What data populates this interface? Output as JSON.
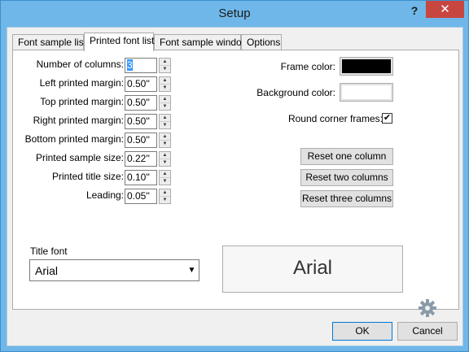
{
  "window": {
    "title": "Setup",
    "help_label": "?",
    "close_label": "✕"
  },
  "tabs": [
    {
      "label": "Font sample list",
      "active": false
    },
    {
      "label": "Printed font list",
      "active": true
    },
    {
      "label": "Font sample window",
      "active": false
    },
    {
      "label": "Options",
      "active": false
    }
  ],
  "fields": {
    "columns": {
      "label": "Number of columns:",
      "value": "3"
    },
    "left_margin": {
      "label": "Left printed margin:",
      "value": "0.50''"
    },
    "top_margin": {
      "label": "Top printed margin:",
      "value": "0.50''"
    },
    "right_margin": {
      "label": "Right printed margin:",
      "value": "0.50''"
    },
    "bottom_margin": {
      "label": "Bottom printed margin:",
      "value": "0.50''"
    },
    "sample_size": {
      "label": "Printed sample size:",
      "value": "0.22''"
    },
    "title_size": {
      "label": "Printed title size:",
      "value": "0.10''"
    },
    "leading": {
      "label": "Leading:",
      "value": "0.05''"
    }
  },
  "colors": {
    "frame_label": "Frame color:",
    "frame_color": "#000000",
    "background_label": "Background color:",
    "background_color": "#ffffff"
  },
  "round_corners": {
    "label": "Round corner frames:",
    "checked": true
  },
  "buttons": {
    "reset_one": "Reset one column",
    "reset_two": "Reset two columns",
    "reset_three": "Reset three columns",
    "ok": "OK",
    "cancel": "Cancel"
  },
  "title_font": {
    "label": "Title font",
    "value": "Arial"
  },
  "preview": {
    "text": "Arial"
  },
  "icons": {
    "gear": "gear-icon",
    "spin_up": "▲",
    "spin_down": "▼",
    "dropdown": "▼",
    "check": "✔"
  }
}
